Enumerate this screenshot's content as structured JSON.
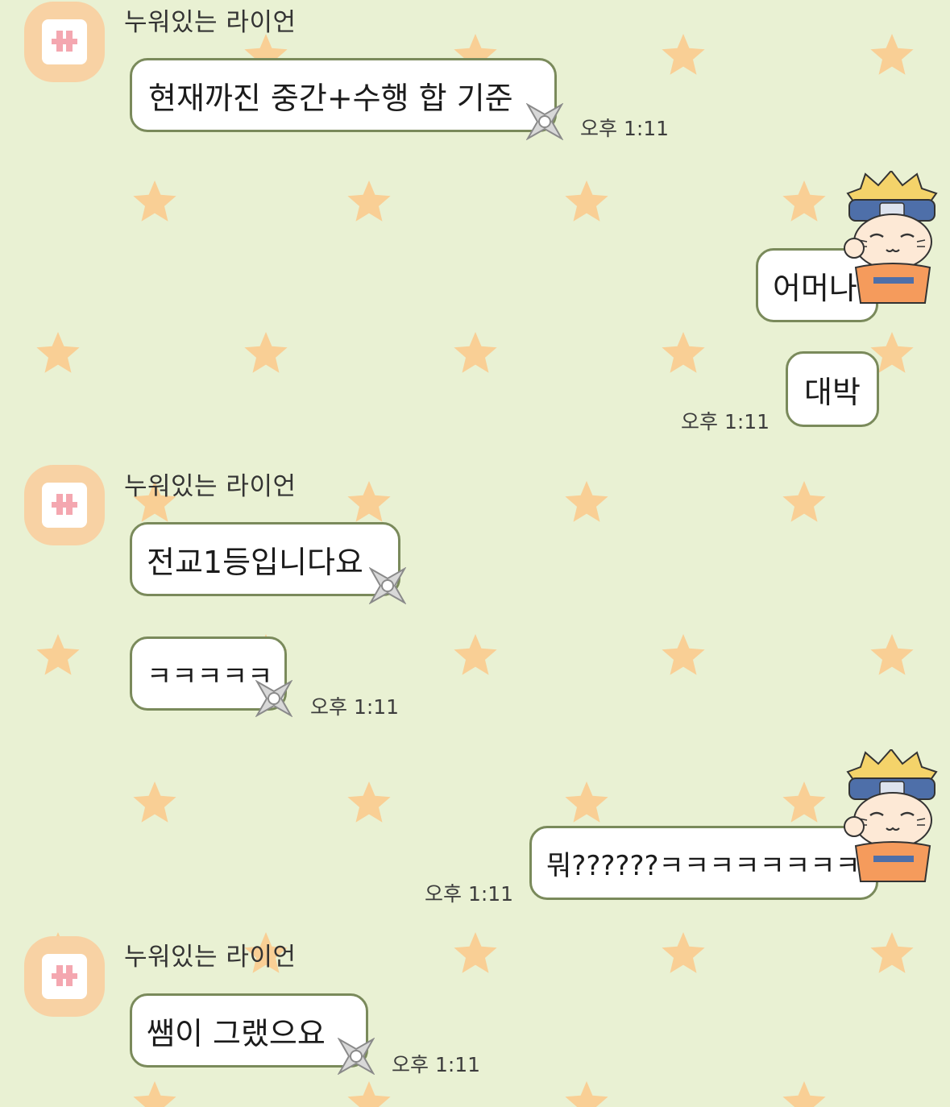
{
  "sender_name": "누워있는 라이언",
  "icons": {
    "avatar": "pink-bow-avatar-icon",
    "bubble_decoration": "shuriken-icon",
    "my_sticker": "naruto-sticker-icon",
    "background": "star-icon"
  },
  "colors": {
    "background": "#e9f1d3",
    "bubble_border": "#7a8a5b",
    "star": "#f9cf95",
    "avatar": "#f8d2a4"
  },
  "messages": [
    {
      "from": "other",
      "show_name": true,
      "text": "현재까진 중간+수행 합 기준",
      "time": "오후 1:11"
    },
    {
      "from": "me",
      "text": "어머나",
      "time": ""
    },
    {
      "from": "me",
      "text": "대박",
      "time": "오후 1:11"
    },
    {
      "from": "other",
      "show_name": true,
      "text": "전교1등입니다요",
      "time": ""
    },
    {
      "from": "other",
      "text": "ㅋㅋㅋㅋㅋ",
      "time": "오후 1:11"
    },
    {
      "from": "me",
      "text": "뭐??????ㅋㅋㅋㅋㅋㅋㅋㅋㅋㅋ",
      "time": "오후 1:11"
    },
    {
      "from": "other",
      "show_name": true,
      "text": "쌤이 그랬으요",
      "time": "오후 1:11"
    }
  ]
}
